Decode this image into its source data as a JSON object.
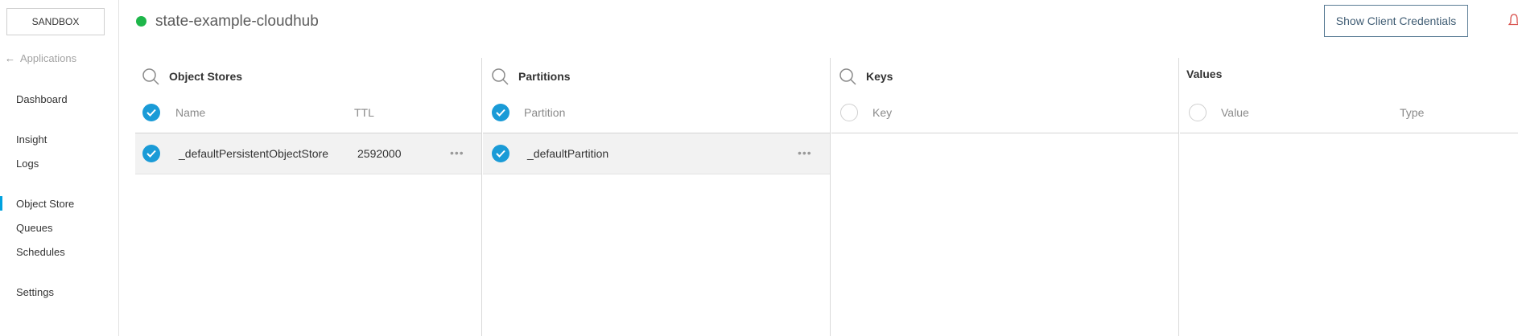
{
  "sidebar": {
    "environment_label": "SANDBOX",
    "back_label": "Applications",
    "items": [
      {
        "label": "Dashboard"
      },
      {
        "label": "Insight"
      },
      {
        "label": "Logs"
      },
      {
        "label": "Object Store"
      },
      {
        "label": "Queues"
      },
      {
        "label": "Schedules"
      },
      {
        "label": "Settings"
      }
    ],
    "active_item": "Object Store"
  },
  "header": {
    "app_name": "state-example-cloudhub",
    "status": "running",
    "status_color": "#1eb64a",
    "credentials_button": "Show Client Credentials"
  },
  "panels": {
    "object_stores": {
      "title": "Object Stores",
      "columns": {
        "name": "Name",
        "ttl": "TTL"
      },
      "rows": [
        {
          "name": "_defaultPersistentObjectStore",
          "ttl": "2592000",
          "selected": true
        }
      ]
    },
    "partitions": {
      "title": "Partitions",
      "columns": {
        "partition": "Partition"
      },
      "rows": [
        {
          "partition": "_defaultPartition",
          "selected": true
        }
      ]
    },
    "keys": {
      "title": "Keys",
      "columns": {
        "key": "Key"
      },
      "rows": []
    },
    "values": {
      "title": "Values",
      "columns": {
        "value": "Value",
        "type": "Type"
      },
      "rows": []
    }
  },
  "colors": {
    "accent": "#1a9bd7",
    "active_nav": "#00a2df",
    "button_border": "#5a7c95"
  },
  "icons": {
    "back": "arrow-left-icon",
    "search": "search-icon",
    "check": "checkmark-icon",
    "more": "ellipsis-icon",
    "notifications": "bell-icon"
  }
}
